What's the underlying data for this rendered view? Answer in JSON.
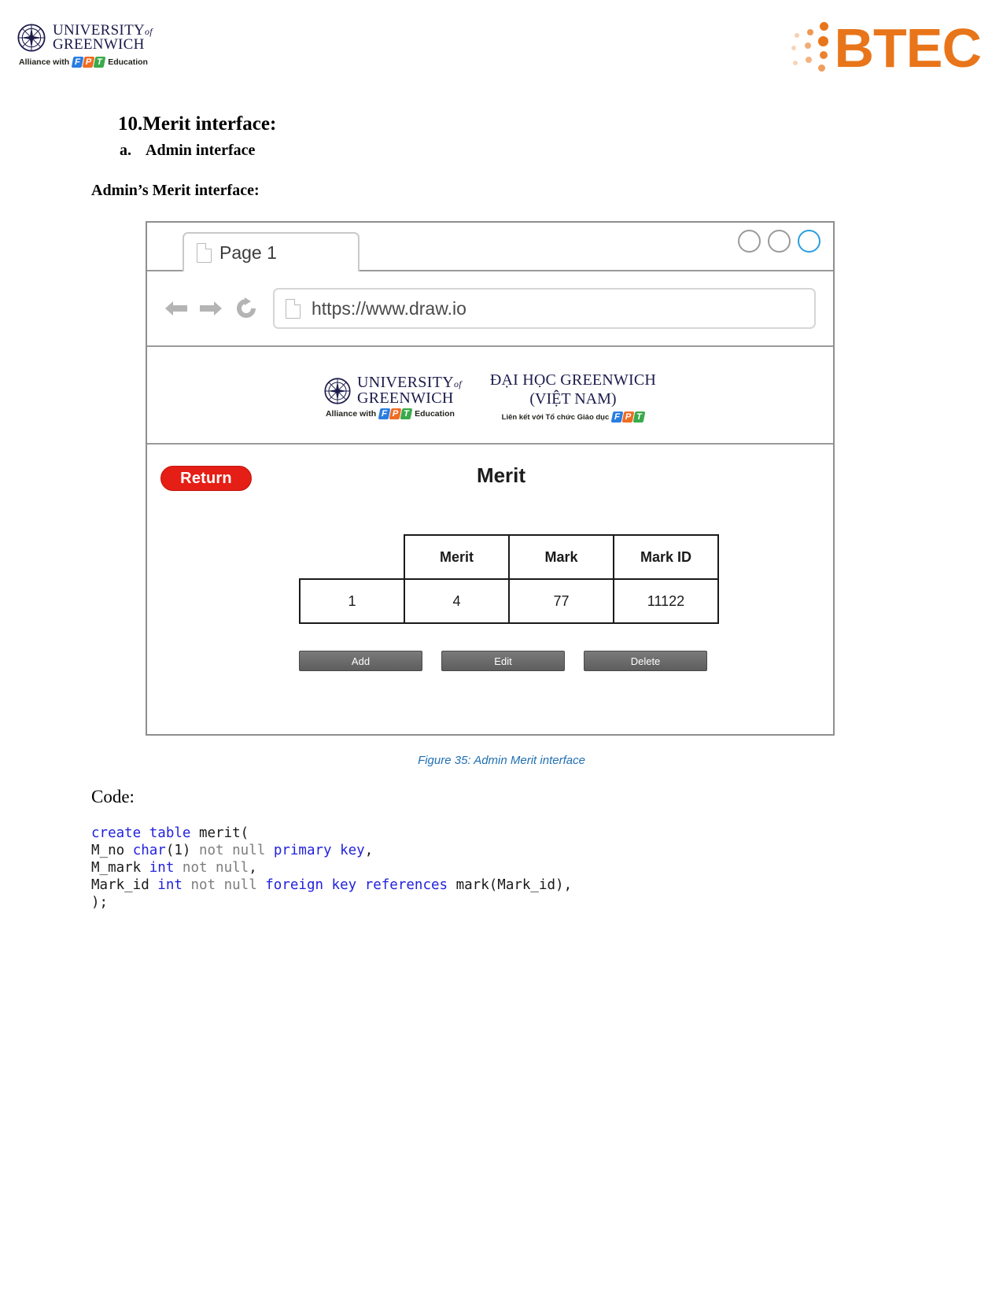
{
  "page_header": {
    "university": {
      "line1": "UNIVERSITY",
      "line1_suffix": "of",
      "line2": "GREENWICH",
      "alliance_prefix": "Alliance with",
      "alliance_suffix": "Education",
      "fpt": {
        "f": "F",
        "p": "P",
        "t": "T"
      }
    },
    "btec": {
      "word": "BTEC",
      "color": "#e8751a"
    }
  },
  "document": {
    "heading_number": "10.",
    "heading_title": "Merit interface:",
    "sub_marker": "a.",
    "sub_label": "Admin interface",
    "section_label": "Admin’s Merit interface:",
    "figure_caption": "Figure 35: Admin Merit interface",
    "code_label": "Code:"
  },
  "mockup": {
    "tab": {
      "label": "Page 1",
      "icon": "document-icon"
    },
    "window_controls": [
      {
        "name": "minimize",
        "color": "#9b9b9b"
      },
      {
        "name": "maximize",
        "color": "#9b9b9b"
      },
      {
        "name": "close",
        "color": "#2b9fe0"
      }
    ],
    "toolbar": {
      "back_icon": "arrow-left-icon",
      "forward_icon": "arrow-right-icon",
      "reload_icon": "reload-icon",
      "url": "https://www.draw.io",
      "url_icon": "document-icon"
    },
    "brand": {
      "left": {
        "line1": "UNIVERSITY",
        "line1_suffix": "of",
        "line2": "GREENWICH",
        "alliance_prefix": "Alliance with",
        "alliance_suffix": "Education"
      },
      "right": {
        "line1": "ĐẠI HỌC GREENWICH",
        "line2": "(VIỆT NAM)",
        "alliance_vn": "Liên kết với Tổ chức Giáo dục"
      }
    },
    "screen": {
      "return_label": "Return",
      "title": "Merit",
      "table": {
        "headers": [
          "",
          "Merit",
          "Mark",
          "Mark ID"
        ],
        "rows": [
          [
            "1",
            "4",
            "77",
            "11122"
          ]
        ]
      },
      "buttons": [
        {
          "label": "Add"
        },
        {
          "label": "Edit"
        },
        {
          "label": "Delete"
        }
      ]
    }
  },
  "code": {
    "lines": [
      [
        {
          "t": "create table ",
          "c": "kw"
        },
        {
          "t": "merit(",
          "c": "plain"
        }
      ],
      [
        {
          "t": "M_no ",
          "c": "plain"
        },
        {
          "t": "char",
          "c": "kw"
        },
        {
          "t": "(1)",
          "c": "plain"
        },
        {
          "t": " not null ",
          "c": "dim"
        },
        {
          "t": "primary key",
          "c": "kw"
        },
        {
          "t": ",",
          "c": "plain"
        }
      ],
      [
        {
          "t": "M_mark ",
          "c": "plain"
        },
        {
          "t": "int",
          "c": "kw"
        },
        {
          "t": " not null",
          "c": "dim"
        },
        {
          "t": ",",
          "c": "plain"
        }
      ],
      [
        {
          "t": "Mark_id ",
          "c": "plain"
        },
        {
          "t": "int",
          "c": "kw"
        },
        {
          "t": " not null ",
          "c": "dim"
        },
        {
          "t": "foreign key references",
          "c": "kw"
        },
        {
          "t": " mark(Mark_id),",
          "c": "plain"
        }
      ],
      [
        {
          "t": ");",
          "c": "plain"
        }
      ]
    ]
  }
}
